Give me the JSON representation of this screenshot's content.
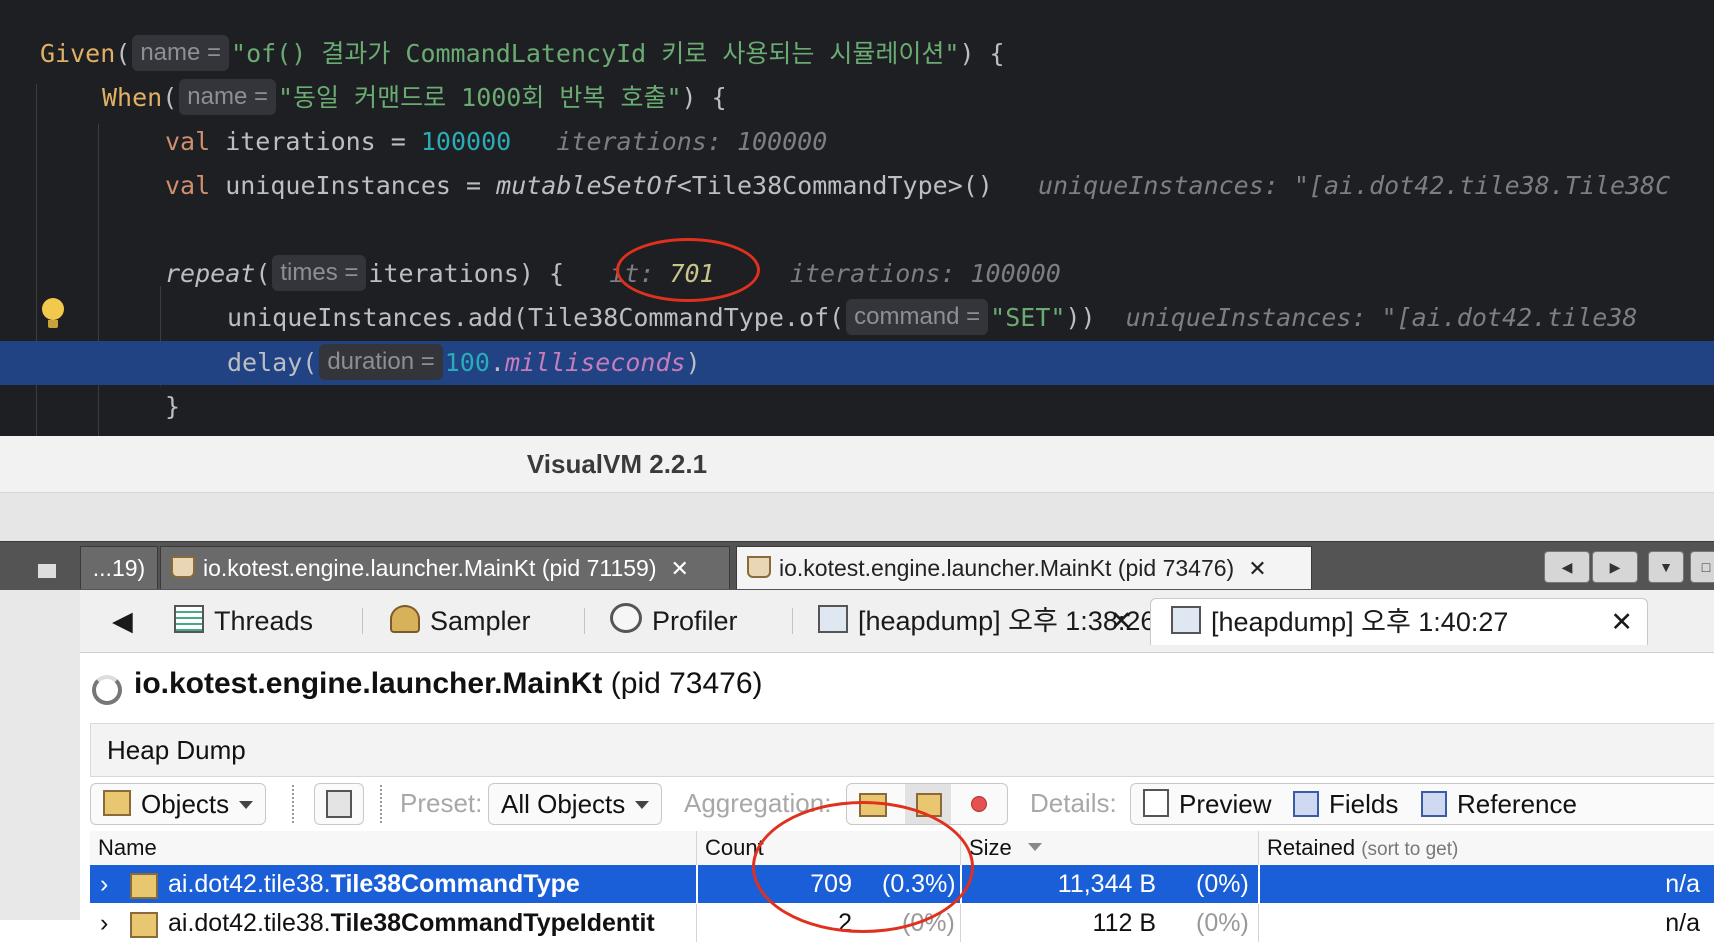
{
  "editor": {
    "given_fn": "Given",
    "given_hint": "name =",
    "given_str": "\"of() 결과가 CommandLatencyId 키로 사용되는 시뮬레이션\"",
    "given_tail": ") {",
    "when_fn": "When",
    "when_hint": "name =",
    "when_str": "\"동일 커맨드로 1000회 반복 호출\"",
    "when_tail": ") {",
    "val_kw": "val",
    "iter_name": " iterations = ",
    "iter_value": "100000",
    "iter_debug": "iterations: 100000",
    "unique_name": " uniqueInstances = ",
    "unique_call": "mutableSetOf",
    "unique_type": "<Tile38CommandType>()",
    "unique_debug": "uniqueInstances: \"[ai.dot42.tile38.Tile38C",
    "repeat_fn": "repeat",
    "repeat_hint": "times =",
    "repeat_tail": "iterations) {",
    "it_label": "it: ",
    "it_value": "701",
    "repeat_debug": "iterations: 100000",
    "add_call": "uniqueInstances.add(Tile38CommandType.of(",
    "add_hint": "command =",
    "add_str": "\"SET\"",
    "add_tail": "))",
    "add_debug": "uniqueInstances: \"[ai.dot42.tile38",
    "delay_fn": "delay(",
    "delay_hint": "duration =",
    "delay_num": "100",
    "delay_dot": ".",
    "delay_prop": "milliseconds",
    "delay_tail": ")",
    "close_brace": "}"
  },
  "window_title": "VisualVM 2.2.1",
  "app_tabs": [
    {
      "label": "...19)"
    },
    {
      "label": "io.kotest.engine.launcher.MainKt (pid 71159)",
      "close": "✕"
    },
    {
      "label": "io.kotest.engine.launcher.MainKt (pid 73476)",
      "close": "✕"
    }
  ],
  "view_tabs": {
    "back": "◀",
    "threads": "Threads",
    "sampler": "Sampler",
    "profiler": "Profiler",
    "heapdump1": "[heapdump] 오후 1:38:26",
    "heapdump2": "[heapdump] 오후 1:40:27",
    "close": "✕"
  },
  "app_header": {
    "name": "io.kotest.engine.launcher.MainKt",
    "pid": "(pid 73476)"
  },
  "heap_dump_label": "Heap Dump",
  "toolbar": {
    "objects": "Objects",
    "preset_label": "Preset:",
    "preset_value": "All Objects",
    "aggregation_label": "Aggregation:",
    "details_label": "Details:",
    "preview": "Preview",
    "fields": "Fields",
    "references": "Reference"
  },
  "table": {
    "headers": {
      "name": "Name",
      "count": "Count",
      "size": "Size",
      "retained": "Retained",
      "retained_hint": "(sort to get)"
    },
    "rows": [
      {
        "expander": "›",
        "pkg": "ai.dot42.tile38.",
        "cls": "Tile38CommandType",
        "count": "709",
        "count_pct": "(0.3%)",
        "size": "11,344 B",
        "size_pct": "(0%)",
        "retained": "n/a"
      },
      {
        "expander": "›",
        "pkg": "ai.dot42.tile38.",
        "cls": "Tile38CommandTypeIdentit",
        "count": "2",
        "count_pct": "(0%)",
        "size": "112 B",
        "size_pct": "(0%)",
        "retained": "n/a"
      }
    ]
  },
  "colors": {
    "editor_bg": "#1e1f22",
    "selection": "#214283",
    "row_selected": "#1a5fd8",
    "annotation": "#e0301e"
  }
}
